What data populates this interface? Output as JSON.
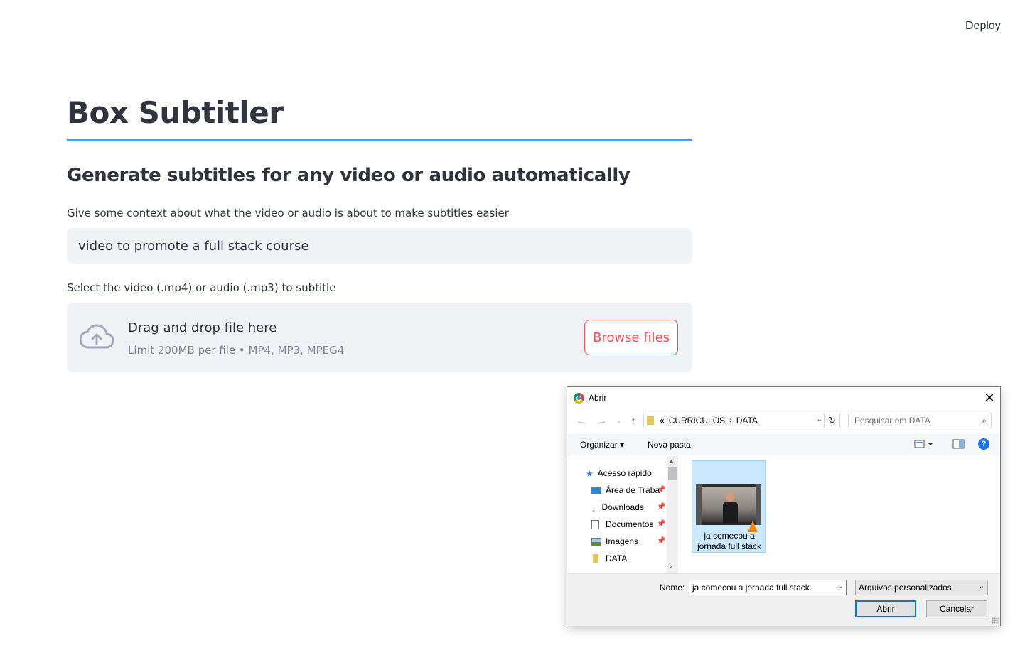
{
  "header": {
    "deploy_label": "Deploy"
  },
  "main": {
    "title": "Box Subtitler",
    "subtitle": "Generate subtitles for any video or audio automatically",
    "context_label": "Give some context about what the video or audio is about to make subtitles easier",
    "context_value": "video to promote a full stack course",
    "file_label": "Select the video (.mp4) or audio (.mp3) to subtitle",
    "dropzone_title": "Drag and drop file here",
    "dropzone_limit": "Limit 200MB per file • MP4, MP3, MPEG4",
    "browse_label": "Browse files",
    "accent_color": "#ff4b4b",
    "rule_color": "#4c9be8"
  },
  "dialog": {
    "title": "Abrir",
    "breadcrumb": [
      "«",
      "CURRICULOS",
      "›",
      "DATA"
    ],
    "search_placeholder": "Pesquisar em DATA",
    "toolbar": {
      "organize": "Organizar ▾",
      "new_folder": "Nova pasta",
      "help": "?"
    },
    "nav_items": [
      {
        "label": "Acesso rápido",
        "icon": "star-icon"
      },
      {
        "label": "Área de Traba",
        "icon": "desktop-icon",
        "pinned": true
      },
      {
        "label": "Downloads",
        "icon": "download-icon",
        "pinned": true
      },
      {
        "label": "Documentos",
        "icon": "document-icon",
        "pinned": true
      },
      {
        "label": "Imagens",
        "icon": "image-icon",
        "pinned": true
      },
      {
        "label": "DATA",
        "icon": "folder-icon"
      }
    ],
    "file": {
      "name_line1": "ja comecou a",
      "name_line2": "jornada full stack"
    },
    "name_label": "Nome:",
    "name_value": "ja comecou a jornada full stack",
    "file_type": "Arquivos personalizados",
    "open_button": "Abrir",
    "cancel_button": "Cancelar"
  }
}
